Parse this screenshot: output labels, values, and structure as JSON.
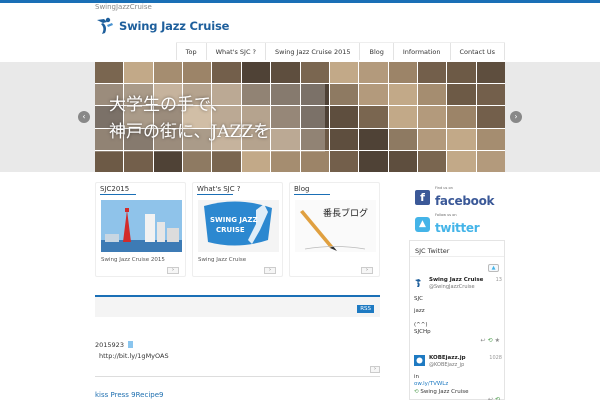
{
  "header": {
    "small_sitename": "SwingJazzCruise",
    "logo_text": "Swing Jazz Cruise"
  },
  "nav": {
    "items": [
      "Top",
      "What's SJC ?",
      "Swing Jazz Cruise 2015",
      "Blog",
      "Information",
      "Contact Us"
    ]
  },
  "slider": {
    "line1": "大学生の手で、",
    "line2": "神戸の街に、JAZZを",
    "prev": "‹",
    "next": "›"
  },
  "cards": [
    {
      "title": "SJC2015",
      "caption": "Swing Jazz Cruise 2015",
      "more": "›"
    },
    {
      "title": "What's SJC ?",
      "caption": "Swing Jazz Cruise",
      "more": "›",
      "image_text": "SWING JAZZ CRUISE"
    },
    {
      "title": "Blog",
      "caption": "",
      "more": "›",
      "image_text": "番長ブログ"
    }
  ],
  "news": {
    "rss_label": "RSS",
    "entries": [
      {
        "date": "2015923",
        "link": "http://bit.ly/1gMyOAS",
        "more": "›"
      },
      {
        "title": "kiss Press 9Recipe9"
      }
    ]
  },
  "sidebar": {
    "facebook": {
      "find_us": "Find us on",
      "word": "facebook"
    },
    "twitter": {
      "follow_us": "Follow us on",
      "word": "twitter"
    },
    "widget": {
      "title": "SJC Twitter",
      "follow_icon": "bird-icon",
      "tweets": [
        {
          "name": "Swing Jazz Cruise",
          "handle": "@SwingJazzCruise",
          "time": "13",
          "lines": [
            "SJC",
            "jazz",
            "(^^)",
            "SJCHp"
          ]
        },
        {
          "name": "KOBEjazz.jp",
          "handle": "@KOBEjazz_jp",
          "time": "1028",
          "lines": [
            "in",
            "ow.ly/TVWLz"
          ],
          "retweet_by": "Swing Jazz Cruise"
        }
      ]
    }
  },
  "colors": {
    "accent": "#1a6fb6",
    "facebook": "#3b5998",
    "twitter": "#44b4e8"
  }
}
